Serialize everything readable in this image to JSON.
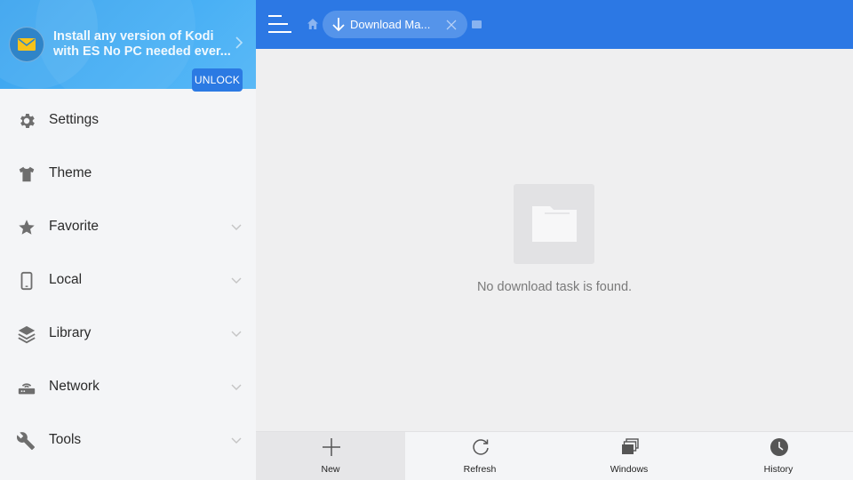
{
  "promo": {
    "line1": "Install any version of Kodi",
    "line2": "with ES No PC needed ever..."
  },
  "sidebar": {
    "items": [
      {
        "label": "Settings",
        "icon": "gear-icon"
      },
      {
        "label": "Theme",
        "icon": "shirt-icon",
        "badge": "UNLOCK"
      },
      {
        "label": "Favorite",
        "icon": "star-icon"
      },
      {
        "label": "Local",
        "icon": "phone-icon"
      },
      {
        "label": "Library",
        "icon": "layers-icon"
      },
      {
        "label": "Network",
        "icon": "router-icon"
      },
      {
        "label": "Tools",
        "icon": "wrench-icon"
      }
    ]
  },
  "topbar": {
    "tab_label": "Download Ma..."
  },
  "main": {
    "empty_message": "No download task is found."
  },
  "bottombar": {
    "items": [
      {
        "label": "New",
        "icon": "plus-icon"
      },
      {
        "label": "Refresh",
        "icon": "refresh-icon"
      },
      {
        "label": "Windows",
        "icon": "windows-icon"
      },
      {
        "label": "History",
        "icon": "clock-icon"
      }
    ]
  },
  "colors": {
    "accent": "#2c78e4",
    "promo": "#45acf3",
    "unlock": "#2b7ae3"
  }
}
